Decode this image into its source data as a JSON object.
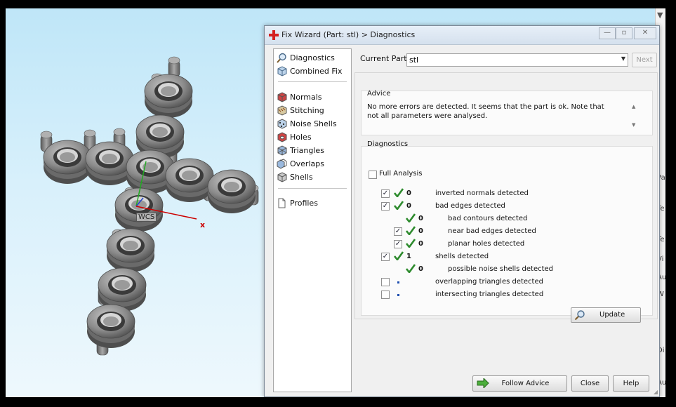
{
  "viewport": {
    "wcs_label": "WCS",
    "x_axis_label": "x"
  },
  "right_strip": {
    "labels": [
      "Pa",
      "Te",
      "Te",
      "Vi",
      "Au",
      "W",
      "Di",
      "Au"
    ]
  },
  "dialog": {
    "title": "Fix Wizard (Part: stl) > Diagnostics",
    "nav": {
      "top": [
        "Diagnostics",
        "Combined Fix"
      ],
      "tools": [
        "Normals",
        "Stitching",
        "Noise Shells",
        "Holes",
        "Triangles",
        "Overlaps",
        "Shells"
      ],
      "bottom": [
        "Profiles"
      ]
    },
    "current_part_label": "Current Part:",
    "current_part_value": "stl",
    "next_label": "Next",
    "advice": {
      "title": "Advice",
      "text": "No more errors are detected. It seems that the part is ok. Note that not all parameters were analysed."
    },
    "diagnostics": {
      "title": "Diagnostics",
      "full_analysis_label": "Full Analysis",
      "rows": [
        {
          "count": "0",
          "label": "inverted normals detected"
        },
        {
          "count": "0",
          "label": "bad edges detected"
        },
        {
          "count": "0",
          "label": "bad contours detected"
        },
        {
          "count": "0",
          "label": "near bad edges detected"
        },
        {
          "count": "0",
          "label": "planar holes detected"
        },
        {
          "count": "1",
          "label": "shells detected"
        },
        {
          "count": "0",
          "label": "possible noise shells detected"
        },
        {
          "count": "",
          "label": "overlapping triangles detected"
        },
        {
          "count": "",
          "label": "intersecting triangles detected"
        }
      ],
      "update_label": "Update"
    },
    "buttons": {
      "follow_advice": "Follow Advice",
      "close": "Close",
      "help": "Help"
    }
  },
  "colors": {
    "check_green": "#2e8b2e",
    "model_gray": "#8c8c8c",
    "axis_red": "#cc0000",
    "axis_green": "#22aa22",
    "axis_blue": "#2244cc"
  }
}
